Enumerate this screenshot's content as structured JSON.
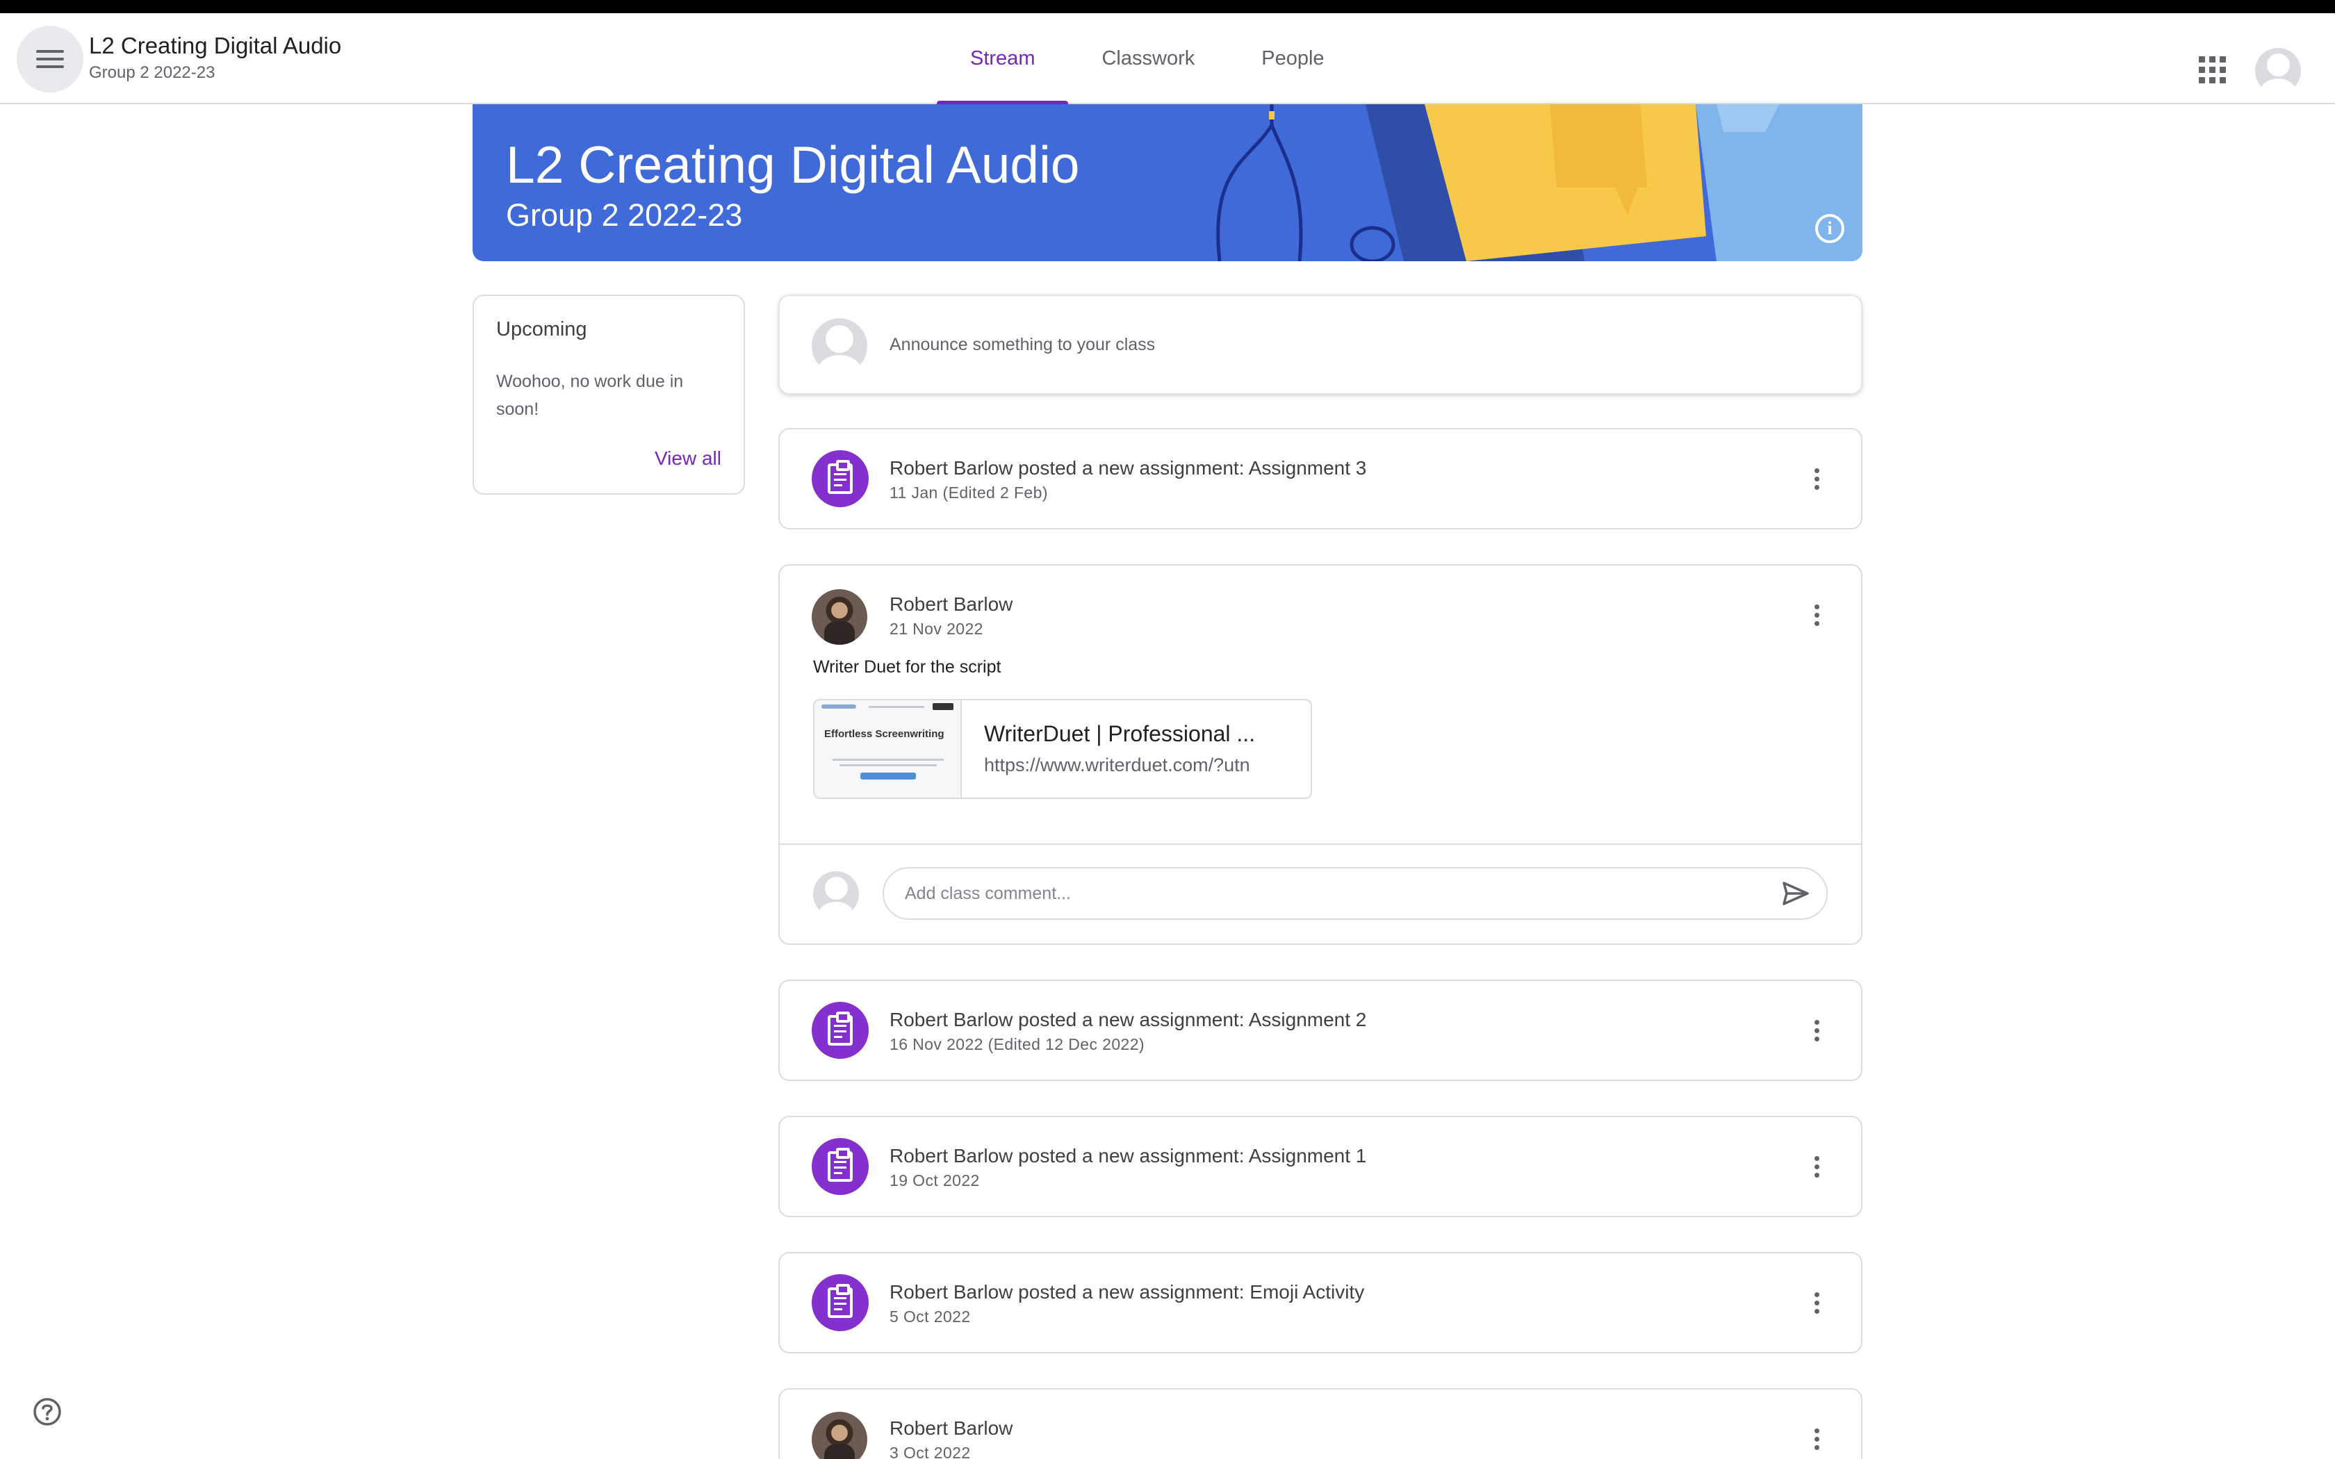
{
  "header": {
    "class_title": "L2 Creating Digital Audio",
    "class_subtitle": "Group 2 2022-23",
    "tabs": [
      {
        "label": "Stream",
        "active": true
      },
      {
        "label": "Classwork",
        "active": false
      },
      {
        "label": "People",
        "active": false
      }
    ]
  },
  "banner": {
    "title": "L2 Creating Digital Audio",
    "subtitle": "Group 2 2022-23",
    "info_icon": "i",
    "color": "#3f6ad8"
  },
  "upcoming": {
    "heading": "Upcoming",
    "message": "Woohoo, no work due in soon!",
    "view_all": "View all"
  },
  "announce": {
    "placeholder": "Announce something to your class"
  },
  "posts": [
    {
      "type": "assignment",
      "title": "Robert Barlow posted a new assignment: Assignment 3",
      "date": "11 Jan (Edited 2 Feb)"
    },
    {
      "type": "material",
      "author": "Robert Barlow",
      "date": "21 Nov 2022",
      "body": "Writer Duet for the script",
      "link": {
        "title": "WriterDuet | Professional ...",
        "url": "https://www.writerduet.com/?utn",
        "thumb_heading": "Effortless Screenwriting"
      },
      "comment_placeholder": "Add class comment..."
    },
    {
      "type": "assignment",
      "title": "Robert Barlow posted a new assignment: Assignment 2",
      "date": "16 Nov 2022 (Edited 12 Dec 2022)"
    },
    {
      "type": "assignment",
      "title": "Robert Barlow posted a new assignment: Assignment 1",
      "date": "19 Oct 2022"
    },
    {
      "type": "assignment",
      "title": "Robert Barlow posted a new assignment: Emoji Activity",
      "date": "5 Oct 2022"
    },
    {
      "type": "material",
      "author": "Robert Barlow",
      "date": "3 Oct 2022"
    }
  ],
  "colors": {
    "accent": "#7627bb",
    "assignment_icon_bg": "#8430ce"
  },
  "icons": {
    "menu": "hamburger-icon",
    "apps": "apps-grid-icon",
    "help": "help-icon",
    "send": "send-icon",
    "more": "more-vert-icon",
    "assignment": "assignment-icon"
  }
}
